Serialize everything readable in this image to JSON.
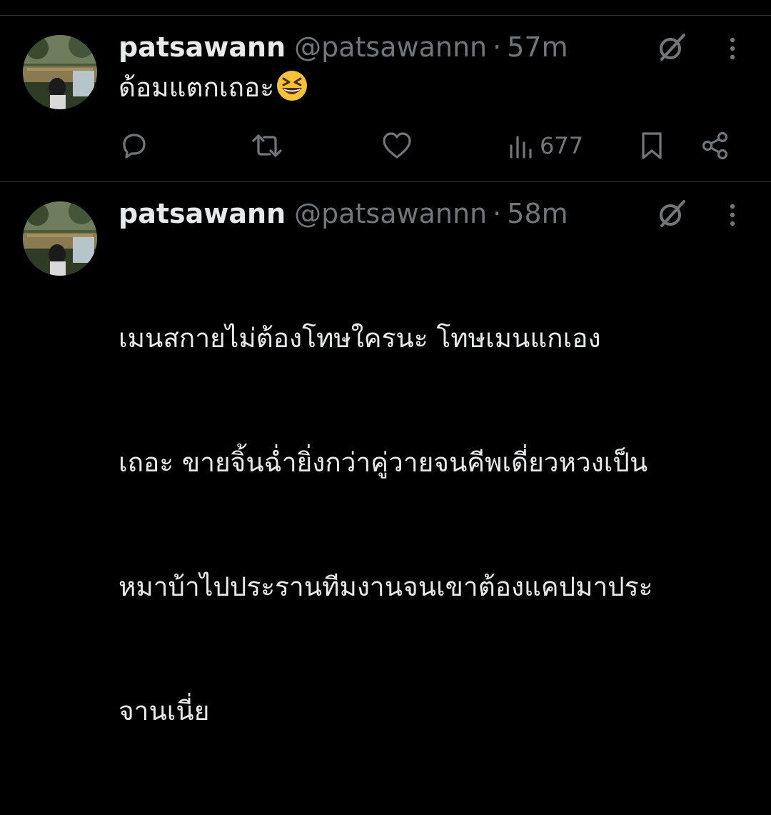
{
  "theme": {
    "background": "#000000",
    "text_primary": "#e7e9ea",
    "text_secondary": "#71767b",
    "divider": "#2f3336"
  },
  "tweets": [
    {
      "display_name": "patsawann",
      "handle": "@patsawannn",
      "separator": "·",
      "time": "57m",
      "text": "ด้อมแตกเถอะ",
      "emoji": "grinning-squinting-face",
      "actions": {
        "reply_icon": "reply-icon",
        "retweet_icon": "retweet-icon",
        "like_icon": "heart-icon",
        "views_icon": "views-icon",
        "views_count": "677",
        "bookmark_icon": "bookmark-icon",
        "share_icon": "share-icon"
      }
    },
    {
      "display_name": "patsawann",
      "handle": "@patsawannn",
      "separator": "·",
      "time": "58m",
      "text_lines": [
        "เมนสกายไม่ต้องโทษใครนะ โทษเมนแกเอง",
        "เถอะ ขายจิ้นฉ่ำยิ่งกว่าคู่วายจนคีพเดี่ยวหวงเป็น",
        "หมาบ้าไปประรานทีมงานจนเขาต้องแคปมาประ",
        "จานเนี่ย"
      ]
    }
  ]
}
